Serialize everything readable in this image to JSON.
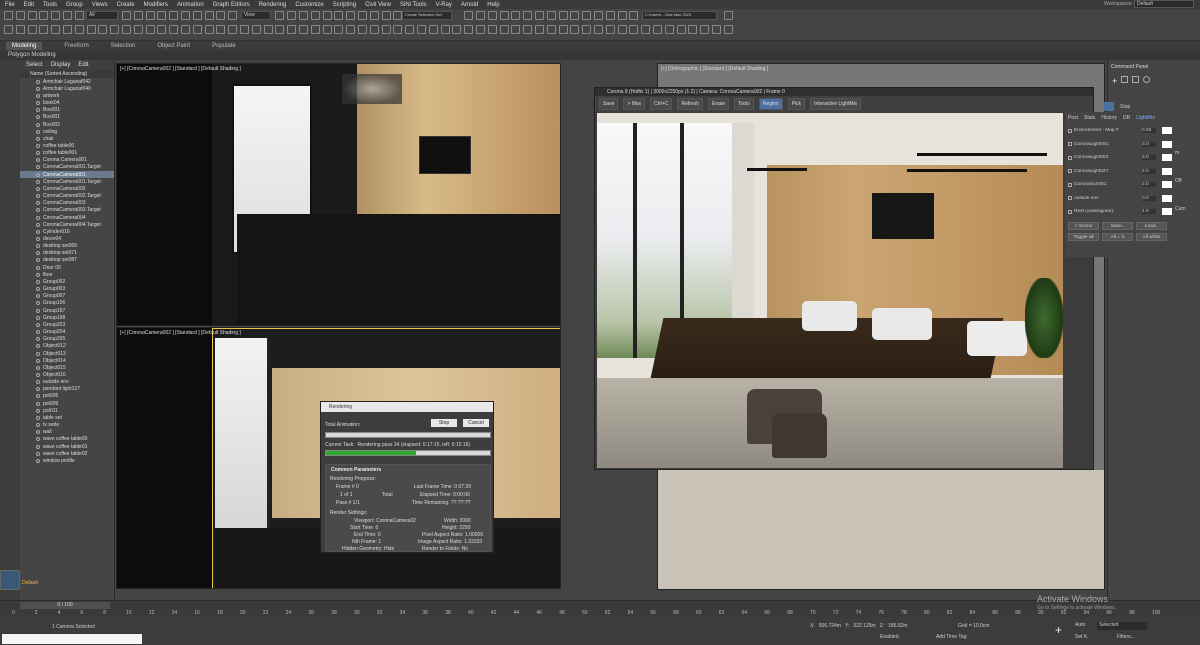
{
  "menu": [
    "File",
    "Edit",
    "Tools",
    "Group",
    "Views",
    "Create",
    "Modifiers",
    "Animation",
    "Graph Editors",
    "Rendering",
    "Customize",
    "Scripting",
    "Civil View",
    "SiNi Tools",
    "V-Ray",
    "Arnold",
    "Help"
  ],
  "workspace": {
    "label": "Workspaces:",
    "value": "Default"
  },
  "toolbar": {
    "filter": "All",
    "view": "View",
    "selection_set": "Create Selection Set",
    "path": "C:\\Users\\...\\3ds Max 2023"
  },
  "ribbon": {
    "tabs": [
      "Modeling",
      "Freeform",
      "Selection",
      "Object Paint",
      "Populate"
    ],
    "sub": "Polygon Modeling"
  },
  "scene_explorer": {
    "menu": [
      "Select",
      "Display",
      "Edit"
    ],
    "header": "Name (Sorted Ascending)",
    "items": [
      "Armchair Lagunaf042",
      "Armchair Lagunaf040",
      "artwork",
      "book04",
      "Box001",
      "Box001",
      "Box002",
      "ceiling",
      "chair",
      "coffee table00",
      "coffee table001",
      "Corona Camera001",
      "CoronaCamera001.Target",
      "CoronaCamera001",
      "CoronaCamera001.Target",
      "CoronaCamera002",
      "CoronaCamera002.Target",
      "CoronaCamera003",
      "CoronaCamera003.Target",
      "CoronaCamera004",
      "CoronaCamera004.Target",
      "Cylinder016",
      "decor04",
      "desktop set069",
      "desktop set071",
      "desktop set087",
      "Door 00",
      "floor",
      "Group002",
      "Group003",
      "Group007",
      "Group196",
      "Group197",
      "Group198",
      "Group203",
      "Group204",
      "Group205",
      "Object012",
      "Object013",
      "Object014",
      "Object015",
      "Object016",
      "outside env",
      "pendant light137",
      "pot005",
      "pot009",
      "pot011",
      "table set",
      "tv sette",
      "wall",
      "wave coffee table00",
      "wave coffee table01",
      "wave coffee table02",
      "window profile"
    ],
    "selected_index": 13,
    "layer": "Default"
  },
  "viewports": {
    "top_left": "[+] [CoronaCamera002 ] [Standard ] [Default Shading ]",
    "bottom_left": "[+] [CoronaCamera002 ] [Standard ] [Default Shading ]",
    "top_right": "[+] [Orthographic ] [Standard ] [Default Shading ]"
  },
  "vfb": {
    "title": "Corona 9 (Hotfix 1) | 3000x2250px (1:2) | Camera: CoronaCamera002 | Frame 0",
    "tools": [
      "Save",
      "> Max",
      "Ctrl+C",
      "Refresh",
      "Erase",
      "Tools",
      "Region",
      "Pick",
      "Interactive LightMix"
    ],
    "stop": "Stop",
    "tabs": [
      "Post",
      "Stats",
      "History",
      "DR",
      "LightMix"
    ],
    "lightmix": [
      {
        "name": "Environment - Map #",
        "val": "0.00"
      },
      {
        "name": "CoronaLight001:",
        "val": "3.0"
      },
      {
        "name": "CoronaLight002:",
        "val": "3.0"
      },
      {
        "name": "CoronaLight027:",
        "val": "2.0"
      },
      {
        "name": "CoronaSun001:",
        "val": "2.0"
      },
      {
        "name": "outside env",
        "val": "0.0"
      },
      {
        "name": "Rest (unassigned):",
        "val": "1.0"
      }
    ],
    "btns": [
      "> Scene",
      "Save..",
      "Load..",
      "Toggle all",
      "All = 0",
      "All white"
    ],
    "side_labels": [
      "m",
      "Off",
      "Cam"
    ]
  },
  "render_dialog": {
    "title": "Rendering",
    "total_animation": "Total Animation:",
    "stop": "Stop",
    "cancel": "Cancel",
    "current_task": "Current Task:",
    "task": "Rendering pass 34 (elapsed: 0:17:15, left: 0:15:16)",
    "progress": 0.55,
    "section": "Common Parameters",
    "progress_title": "Rendering Progress:",
    "frame": "Frame # 0",
    "of": "1 of 1",
    "passes": "Pass # 1/1",
    "total": "Total",
    "last_frame": "Last Frame Time: 0:07:39",
    "elapsed": "Elapsed Time: 0:00:00",
    "remaining": "Time Remaining: ??:??:??",
    "settings": "Render Settings:",
    "viewport": "Viewport: CoronaCamera02",
    "start": "Start Time: 0",
    "end": "End Time: 0",
    "nth": "Nth Frame: 1",
    "hidden": "Hidden Geometry: Hide",
    "width": "Width: 3000",
    "height": "Height: 2250",
    "pixel": "Pixel Aspect Ratio: 1.00000",
    "image": "Image Aspect Ratio: 1.33333",
    "fields": "Render to Fields: No"
  },
  "timeline": {
    "frame": "0 / 100",
    "ticks": [
      "0",
      "2",
      "4",
      "6",
      "8",
      "10",
      "12",
      "14",
      "16",
      "18",
      "20",
      "22",
      "24",
      "26",
      "28",
      "30",
      "32",
      "34",
      "36",
      "38",
      "40",
      "42",
      "44",
      "46",
      "48",
      "50",
      "52",
      "54",
      "56",
      "58",
      "60",
      "62",
      "64",
      "66",
      "68",
      "70",
      "72",
      "74",
      "76",
      "78",
      "80",
      "82",
      "84",
      "86",
      "88",
      "90",
      "92",
      "94",
      "96",
      "98",
      "100"
    ]
  },
  "status": {
    "selected": "1 Camera Selected",
    "x": "506.724m",
    "y": "522.125m",
    "z": "186.82m",
    "enabled": "Enabled:",
    "grid": "Grid = 10.0cm",
    "add_time_tag": "Add Time Tag",
    "auto": "Auto",
    "setk": "Set K.",
    "sel": "Selected",
    "filters": "Filters..."
  },
  "watermark": {
    "line1": "Activate Windows",
    "line2": "Go to Settings to activate Windows."
  },
  "command_panel": "Command Panel"
}
